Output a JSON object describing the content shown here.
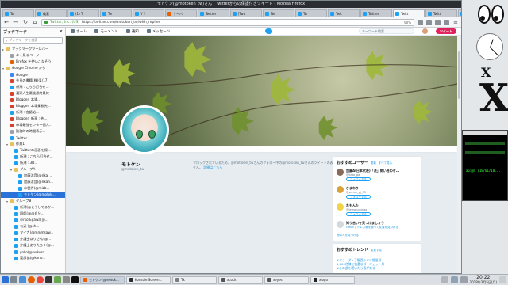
{
  "window": {
    "title": "モトケン(@motoken_tw)さん | Twitterからの保護付きツイート - Mozilla Firefox"
  },
  "tabs": [
    {
      "label": "Tw",
      "icon": "twitter-icon",
      "active": false
    },
    {
      "label": "検索",
      "icon": "twitter-icon",
      "active": false
    },
    {
      "label": "(1) T",
      "icon": "twitter-icon",
      "active": false
    },
    {
      "label": "Tw",
      "icon": "twitter-icon",
      "active": false
    },
    {
      "label": "Y Y",
      "icon": "twitter-icon",
      "active": false
    },
    {
      "label": "サーバ",
      "icon": "firefox-icon",
      "active": false
    },
    {
      "label": "Twitter",
      "icon": "twitter-icon",
      "active": false
    },
    {
      "label": "[Twit",
      "icon": "twitter-icon",
      "active": false
    },
    {
      "label": "Tw",
      "icon": "twitter-icon",
      "active": false
    },
    {
      "label": "Tw",
      "icon": "twitter-icon",
      "active": false
    },
    {
      "label": "Twit",
      "icon": "twitter-icon",
      "active": false
    },
    {
      "label": "Twitter",
      "icon": "twitter-icon",
      "active": false
    },
    {
      "label": "Twitt",
      "icon": "twitter-icon",
      "active": true
    },
    {
      "label": "Twitt",
      "icon": "twitter-icon",
      "active": false
    },
    {
      "label": "(1) T",
      "icon": "twitter-icon",
      "active": false
    },
    {
      "label": "検索結",
      "icon": "green-icon",
      "active": false
    },
    {
      "label": "Twit",
      "icon": "twitter-icon",
      "active": false
    },
    {
      "label": "Twitter",
      "icon": "twitter-icon",
      "active": false
    },
    {
      "label": "(1) T",
      "icon": "twitter-icon",
      "active": false
    }
  ],
  "navbar": {
    "url_site": "Twitter, Inc. (US)",
    "url": "https://twitter.com/motoken_tw/with_replies",
    "zoom": "90%"
  },
  "sidebar": {
    "title": "ブックマーク",
    "search_placeholder": "ブックマークを検索",
    "items": [
      {
        "label": "ブックマークツールバー",
        "indent": 0,
        "icon": "folder",
        "twisty": "▸",
        "selected": false
      },
      {
        "label": "よく見るページ",
        "indent": 1,
        "icon": "gray",
        "twisty": "",
        "selected": false
      },
      {
        "label": "Firefox を使いこなそう",
        "indent": 1,
        "icon": "ff",
        "twisty": "",
        "selected": false
      },
      {
        "label": "Google Chrome から",
        "indent": 0,
        "icon": "folder",
        "twisty": "▾",
        "selected": false
      },
      {
        "label": "Google",
        "indent": 1,
        "icon": "g",
        "twisty": "",
        "selected": false
      },
      {
        "label": "今日の書籍(株)(1/17)",
        "indent": 1,
        "icon": "red",
        "twisty": "",
        "selected": false
      },
      {
        "label": "新潮 : こちら打合せ...",
        "indent": 1,
        "icon": "tw",
        "twisty": "",
        "selected": false
      },
      {
        "label": "漫家人生最後最終最終",
        "indent": 1,
        "icon": "red",
        "twisty": "",
        "selected": false
      },
      {
        "label": "Blogger: 本場...",
        "indent": 1,
        "icon": "red",
        "twisty": "",
        "selected": false
      },
      {
        "label": "Blogger: 本場業務先...",
        "indent": 1,
        "icon": "red",
        "twisty": "",
        "selected": false
      },
      {
        "label": "新潮 : 言語処...",
        "indent": 1,
        "icon": "tw",
        "twisty": "",
        "selected": false
      },
      {
        "label": "Blogger: 新潮 : 先...",
        "indent": 1,
        "icon": "red",
        "twisty": "",
        "selected": false
      },
      {
        "label": "市場最強センター個人...",
        "indent": 1,
        "icon": "red",
        "twisty": "",
        "selected": false
      },
      {
        "label": "勤務時の時間表示...",
        "indent": 1,
        "icon": "gray",
        "twisty": "",
        "selected": false
      },
      {
        "label": "Twitter",
        "indent": 1,
        "icon": "tw",
        "twisty": "",
        "selected": false
      },
      {
        "label": "作業1",
        "indent": 1,
        "icon": "folder",
        "twisty": "▾",
        "selected": false
      },
      {
        "label": "Twitterの画面を保...",
        "indent": 2,
        "icon": "tw",
        "twisty": "",
        "selected": false
      },
      {
        "label": "新潮 : こちら打合せ...",
        "indent": 2,
        "icon": "tw",
        "twisty": "",
        "selected": false
      },
      {
        "label": "新潮 : 3D...",
        "indent": 2,
        "icon": "tw",
        "twisty": "",
        "selected": false
      },
      {
        "label": "グループA",
        "indent": 2,
        "icon": "folder",
        "twisty": "▾",
        "selected": false
      },
      {
        "label": "加藤涼音(@rika_...",
        "indent": 3,
        "icon": "tw",
        "twisty": "",
        "selected": false
      },
      {
        "label": "加藤涼音(@rikan...",
        "indent": 3,
        "icon": "tw",
        "twisty": "",
        "selected": false
      },
      {
        "label": "水雲秀(@mizb...",
        "indent": 3,
        "icon": "tw",
        "twisty": "",
        "selected": false
      },
      {
        "label": "モトケン(@motok...",
        "indent": 3,
        "icon": "tw",
        "twisty": "",
        "selected": true
      },
      {
        "label": "グループB",
        "indent": 1,
        "icon": "folder",
        "twisty": "▾",
        "selected": false
      },
      {
        "label": "新潮(@こうしてるか...",
        "indent": 2,
        "icon": "tw",
        "twisty": "",
        "selected": false
      },
      {
        "label": "四郎(@@自分...",
        "indent": 2,
        "icon": "tw",
        "twisty": "",
        "selected": false
      },
      {
        "label": "小rko Egawa(@...",
        "indent": 2,
        "icon": "tw",
        "twisty": "",
        "selected": false
      },
      {
        "label": "有沢 (@sh...",
        "indent": 2,
        "icon": "tw",
        "twisty": "",
        "selected": false
      },
      {
        "label": "マイカ(@mmmsaw...",
        "indent": 2,
        "icon": "tw",
        "twisty": "",
        "selected": false
      },
      {
        "label": "弁護士ぼりさん(@...",
        "indent": 2,
        "icon": "tw",
        "twisty": "",
        "selected": false
      },
      {
        "label": "弁護士ありたろう(@...",
        "indent": 2,
        "icon": "tw",
        "twisty": "",
        "selected": false
      },
      {
        "label": "yoko(@twikuro...",
        "indent": 2,
        "icon": "tw",
        "twisty": "",
        "selected": false
      },
      {
        "label": "要部協(@kono...",
        "indent": 2,
        "icon": "tw",
        "twisty": "",
        "selected": false
      }
    ]
  },
  "twitter_nav": {
    "home": "ホーム",
    "moments": "モーメント",
    "notifications": "通知",
    "messages": "メッセージ",
    "search_placeholder": "キーワード検索",
    "tweet_button": "ツイート"
  },
  "profile": {
    "name": "モトケン",
    "handle": "@motoken_tw",
    "protected_message": "ブロックされているため、@motoken_twさんのフォロー中の@motoken_twさんのツイートの表示はできません。",
    "protected_link": "詳細はこちら"
  },
  "recommendations": {
    "title": "おすすめユーザー",
    "refresh": "更新",
    "view_all": "すべて見る",
    "follow_label": "フォローする",
    "users": [
      {
        "name": "加藤A(日本代表)「法」問い合わせ...",
        "handle": "@kato_ga",
        "color": "#8a6b5a"
      },
      {
        "name": "ひまわり",
        "handle": "@sunny_yj_35",
        "color": "#d9a23a"
      },
      {
        "name": "れもんた",
        "handle": "@lemongaingo",
        "color": "#f0d34b"
      }
    ],
    "find_title": "知り合いを見つけましょう",
    "find_sub": "Gmailアドレス帳を使って友達を見つける",
    "more": "他の人を見つける"
  },
  "trends": {
    "title": "おすすめトレンド",
    "change": "変更する",
    "items": [
      "#ジョーダン了解西ラジオ開催月",
      "1,000名様に抽選@ゴージェット月",
      "#この曲を聴いたら春が来る"
    ]
  },
  "taskbar": {
    "tasks": [
      {
        "label": "モトケン(@motok...",
        "active": true,
        "color": "#e66000"
      },
      {
        "label": "Konsole Screen...",
        "active": false,
        "color": "#2a2e33"
      },
      {
        "label": "Tk",
        "active": false,
        "color": "#7a7f86"
      },
      {
        "label": "xcock",
        "active": false,
        "color": "#555"
      },
      {
        "label": "xeyes",
        "active": false,
        "color": "#555"
      },
      {
        "label": "xlogo",
        "active": false,
        "color": "#222"
      }
    ],
    "time": "20:22",
    "date": "2018年3月5日(月)"
  },
  "side_terminal": {
    "text": "api@l (18/01/18..."
  }
}
